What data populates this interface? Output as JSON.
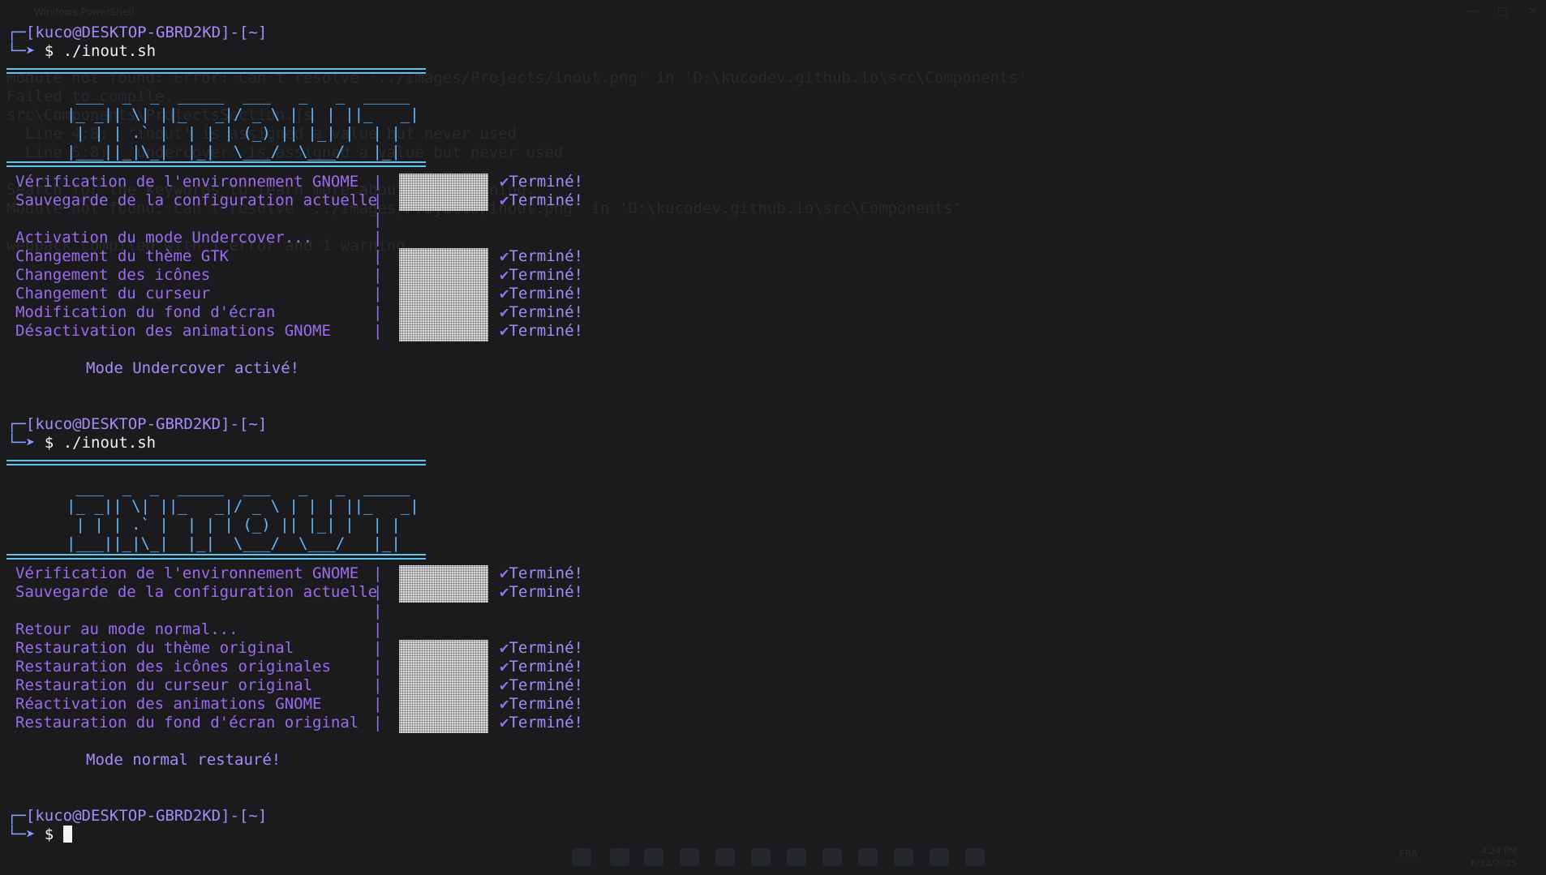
{
  "window": {
    "title": "Windows PowerShell",
    "controls": [
      "—",
      "▢",
      "✕"
    ]
  },
  "background_text": [
    "Module not found: Error: Can't resolve '../images/Projects/inout.png' in 'D:\\kucodev.github.io\\src\\Components'",
    "Failed to compile.",
    "src\\Components\\ProjectsSection.js",
    "  Line 4:8:  'inout' is assigned a value but never used",
    "  Line 5:8:  'undercover' is assigned a value but never used",
    "Search for the keywords to learn more about each warning.",
    "Module not found: Can't resolve '../images/Projects/inout.png' in 'D:\\kucodev.github.io\\src\\Components'",
    "webpack compiled with 1 error and 1 warning"
  ],
  "prompt": {
    "top_corner": "┌─",
    "user_host": "[kuco@DESKTOP-GBRD2KD]-[~]",
    "bottom_corner": "└─➤",
    "dollar": "$"
  },
  "runs": [
    {
      "command": "./inout.sh",
      "banner": [
        " ___  _  _  _____  ___   _   _  _____",
        "|_ _|| \\| ||_   _|/ _ \\ | | | ||_   _|",
        " | | | .` |  | | | (_) || |_| |  | |",
        "|___||_|\\_|  |_|  \\___/  \\___/   |_|"
      ],
      "checks": [
        {
          "label": "Vérification de l'environnement GNOME",
          "status": "Terminé!"
        },
        {
          "label": "Sauvegarde de la configuration actuelle",
          "status": "Terminé!"
        }
      ],
      "section_label": "Activation du mode Undercover...",
      "steps": [
        {
          "label": "Changement du thème GTK",
          "status": "Terminé!"
        },
        {
          "label": "Changement des icônes",
          "status": "Terminé!"
        },
        {
          "label": "Changement du curseur",
          "status": "Terminé!"
        },
        {
          "label": "Modification du fond d'écran",
          "status": "Terminé!"
        },
        {
          "label": "Désactivation des animations GNOME",
          "status": "Terminé!"
        }
      ],
      "result": "Mode Undercover activé!"
    },
    {
      "command": "./inout.sh",
      "banner": [
        " ___  _  _  _____  ___   _   _  _____",
        "|_ _|| \\| ||_   _|/ _ \\ | | | ||_   _|",
        " | | | .` |  | | | (_) || |_| |  | |",
        "|___||_|\\_|  |_|  \\___/  \\___/   |_|"
      ],
      "checks": [
        {
          "label": "Vérification de l'environnement GNOME",
          "status": "Terminé!"
        },
        {
          "label": "Sauvegarde de la configuration actuelle",
          "status": "Terminé!"
        }
      ],
      "section_label": "Retour au mode normal...",
      "steps": [
        {
          "label": "Restauration du thème original",
          "status": "Terminé!"
        },
        {
          "label": "Restauration des icônes originales",
          "status": "Terminé!"
        },
        {
          "label": "Restauration du curseur original",
          "status": "Terminé!"
        },
        {
          "label": "Réactivation des animations GNOME",
          "status": "Terminé!"
        },
        {
          "label": "Restauration du fond d'écran original",
          "status": "Terminé!"
        }
      ],
      "result": "Mode normal restauré!"
    }
  ],
  "progress_value": 1,
  "check_glyph": "✔",
  "pipe_glyph": "|",
  "taskbar": {
    "tray_language": "FRA",
    "clock_time": "4:24 PM",
    "clock_date": "6/13/2025"
  },
  "colors": {
    "background": "#1b1b1d",
    "prompt": "#a78bfa",
    "task_text": "#9a6cf2",
    "banner": "#67b8ff",
    "rule": "#5cc5ee",
    "command": "#f3f3f3"
  }
}
